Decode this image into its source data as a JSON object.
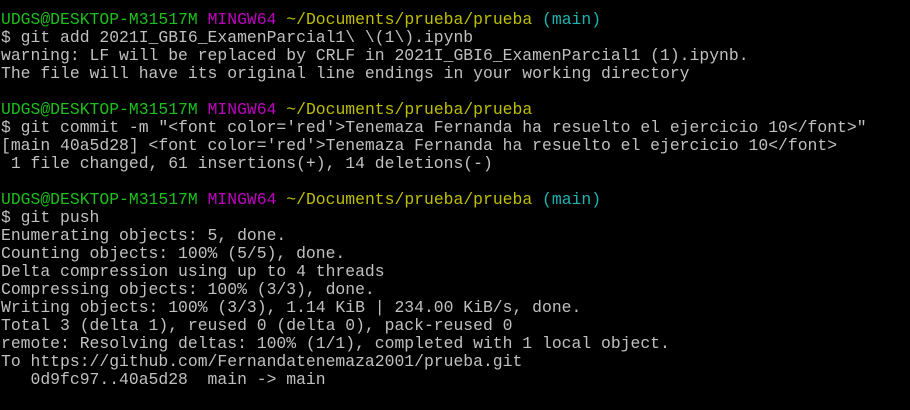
{
  "colors": {
    "background": "#000000",
    "text": "#c0c0c0",
    "user_host": "#1cbf1c",
    "system": "#bf00bf",
    "path": "#bfbf00",
    "branch": "#20b2b2"
  },
  "prompt": {
    "user_host": "UDGS@DESKTOP-M31517M",
    "system": "MINGW64",
    "path": "~/Documents/prueba/prueba",
    "branch": "(main)"
  },
  "blocks": [
    {
      "command": "$ git add 2021I_GBI6_ExamenParcial1\\ \\(1\\).ipynb",
      "output": [
        "warning: LF will be replaced by CRLF in 2021I_GBI6_ExamenParcial1 (1).ipynb.",
        "The file will have its original line endings in your working directory"
      ]
    },
    {
      "command": "$ git commit -m \"<font color='red'>Tenemaza Fernanda ha resuelto el ejercicio 10</font>\"",
      "output": [
        "[main 40a5d28] <font color='red'>Tenemaza Fernanda ha resuelto el ejercicio 10</font>",
        " 1 file changed, 61 insertions(+), 14 deletions(-)"
      ]
    },
    {
      "command": "$ git push",
      "output": [
        "Enumerating objects: 5, done.",
        "Counting objects: 100% (5/5), done.",
        "Delta compression using up to 4 threads",
        "Compressing objects: 100% (3/3), done.",
        "Writing objects: 100% (3/3), 1.14 KiB | 234.00 KiB/s, done.",
        "Total 3 (delta 1), reused 0 (delta 0), pack-reused 0",
        "remote: Resolving deltas: 100% (1/1), completed with 1 local object.",
        "To https://github.com/Fernandatenemaza2001/prueba.git",
        "   0d9fc97..40a5d28  main -> main"
      ]
    }
  ]
}
